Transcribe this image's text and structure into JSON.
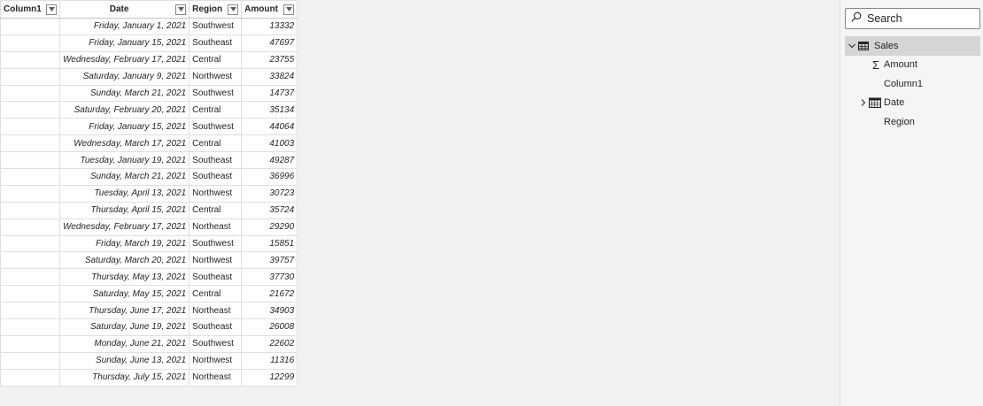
{
  "table": {
    "headers": {
      "column1": "Column1",
      "date": "Date",
      "region": "Region",
      "amount": "Amount"
    },
    "rows": [
      {
        "column1": "",
        "date": "Friday, January 1, 2021",
        "region": "Southwest",
        "amount": "13332"
      },
      {
        "column1": "",
        "date": "Friday, January 15, 2021",
        "region": "Southeast",
        "amount": "47697"
      },
      {
        "column1": "",
        "date": "Wednesday, February 17, 2021",
        "region": "Central",
        "amount": "23755"
      },
      {
        "column1": "",
        "date": "Saturday, January 9, 2021",
        "region": "Northwest",
        "amount": "33824"
      },
      {
        "column1": "",
        "date": "Sunday, March 21, 2021",
        "region": "Southwest",
        "amount": "14737"
      },
      {
        "column1": "",
        "date": "Saturday, February 20, 2021",
        "region": "Central",
        "amount": "35134"
      },
      {
        "column1": "",
        "date": "Friday, January 15, 2021",
        "region": "Southwest",
        "amount": "44064"
      },
      {
        "column1": "",
        "date": "Wednesday, March 17, 2021",
        "region": "Central",
        "amount": "41003"
      },
      {
        "column1": "",
        "date": "Tuesday, January 19, 2021",
        "region": "Southeast",
        "amount": "49287"
      },
      {
        "column1": "",
        "date": "Sunday, March 21, 2021",
        "region": "Southeast",
        "amount": "36996"
      },
      {
        "column1": "",
        "date": "Tuesday, April 13, 2021",
        "region": "Northwest",
        "amount": "30723"
      },
      {
        "column1": "",
        "date": "Thursday, April 15, 2021",
        "region": "Central",
        "amount": "35724"
      },
      {
        "column1": "",
        "date": "Wednesday, February 17, 2021",
        "region": "Northeast",
        "amount": "29290"
      },
      {
        "column1": "",
        "date": "Friday, March 19, 2021",
        "region": "Southwest",
        "amount": "15851"
      },
      {
        "column1": "",
        "date": "Saturday, March 20, 2021",
        "region": "Northwest",
        "amount": "39757"
      },
      {
        "column1": "",
        "date": "Thursday, May 13, 2021",
        "region": "Southeast",
        "amount": "37730"
      },
      {
        "column1": "",
        "date": "Saturday, May 15, 2021",
        "region": "Central",
        "amount": "21672"
      },
      {
        "column1": "",
        "date": "Thursday, June 17, 2021",
        "region": "Northeast",
        "amount": "34903"
      },
      {
        "column1": "",
        "date": "Saturday, June 19, 2021",
        "region": "Southeast",
        "amount": "26008"
      },
      {
        "column1": "",
        "date": "Monday, June 21, 2021",
        "region": "Southwest",
        "amount": "22602"
      },
      {
        "column1": "",
        "date": "Sunday, June 13, 2021",
        "region": "Northwest",
        "amount": "11316"
      },
      {
        "column1": "",
        "date": "Thursday, July 15, 2021",
        "region": "Northeast",
        "amount": "12299"
      }
    ]
  },
  "fields_pane": {
    "search_label": "Search",
    "search_icon": "search-icon",
    "table_name": "Sales",
    "table_icon": "table-icon",
    "fields": [
      {
        "label": "Amount",
        "icon": "sigma-icon"
      },
      {
        "label": "Column1",
        "icon": ""
      },
      {
        "label": "Date",
        "icon": "calendar-icon"
      },
      {
        "label": "Region",
        "icon": ""
      }
    ]
  },
  "colors": {
    "selected_row": "#d6d5d3",
    "grid_border": "#e1dfdd"
  }
}
